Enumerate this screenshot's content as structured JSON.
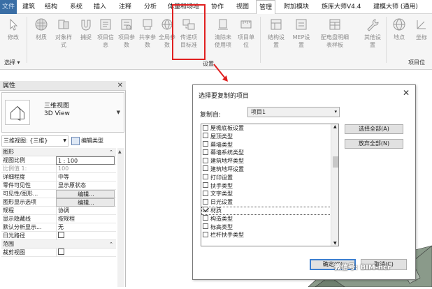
{
  "menubar": {
    "file": "文件",
    "tabs": [
      "建筑",
      "结构",
      "系统",
      "插入",
      "注释",
      "分析",
      "体量和场地",
      "协作",
      "视图",
      "管理",
      "附加模块",
      "族库大师V4.4",
      "建模大师 (通用)"
    ]
  },
  "ribbon": {
    "buttons": [
      {
        "label": "修改",
        "icon": "cursor-icon"
      },
      {
        "label": "材质",
        "icon": "material-sphere-icon"
      },
      {
        "label": "对象样式",
        "icon": "object-styles-icon"
      },
      {
        "label": "捕捉",
        "icon": "snap-magnet-icon"
      },
      {
        "label": "项目信息",
        "icon": "project-info-icon"
      },
      {
        "label": "项目参数",
        "icon": "project-params-icon"
      },
      {
        "label": "共享参数",
        "icon": "shared-params-icon"
      },
      {
        "label": "全局参数",
        "icon": "global-params-icon"
      },
      {
        "label": "传递项目标准",
        "icon": "transfer-standards-icon"
      },
      {
        "label": "清除未使用项",
        "icon": "purge-icon"
      },
      {
        "label": "项目单位",
        "icon": "project-units-icon"
      },
      {
        "label": "结构设置",
        "icon": "structural-settings-icon"
      },
      {
        "label": "MEP设置",
        "icon": "mep-settings-icon"
      },
      {
        "label": "配电盘明细表样板",
        "icon": "panel-schedule-icon"
      },
      {
        "label": "其他设置",
        "icon": "wrench-icon"
      },
      {
        "label": "地点",
        "icon": "location-globe-icon"
      },
      {
        "label": "坐标",
        "icon": "coordinates-icon"
      }
    ],
    "select_panel": "选择",
    "settings_panel": "设置",
    "project_location_panel": "项目位"
  },
  "properties": {
    "title": "属性",
    "type_name": "三维视图",
    "type_sub": "3D View",
    "view_selector": "三维视图: {三维}",
    "edit_type": "编辑类型",
    "sections": {
      "graphics": "图形",
      "extents": "范围"
    },
    "rows": [
      {
        "name": "视图比例",
        "value": "1 : 100"
      },
      {
        "name": "比例值 1:",
        "value": "100"
      },
      {
        "name": "详细程度",
        "value": "中等"
      },
      {
        "name": "零件可见性",
        "value": "显示原状态"
      },
      {
        "name": "可见性/图形...",
        "value": "编辑..."
      },
      {
        "name": "图形显示选项",
        "value": "编辑..."
      },
      {
        "name": "规程",
        "value": "协调"
      },
      {
        "name": "显示隐藏线",
        "value": "按规程"
      },
      {
        "name": "默认分析显示...",
        "value": "无"
      },
      {
        "name": "日光路径",
        "value": ""
      }
    ],
    "extent_rows": [
      {
        "name": "裁剪视图",
        "value": ""
      }
    ]
  },
  "dialog": {
    "title": "选择要复制的项目",
    "copy_from_label": "复制自:",
    "copy_from_value": "项目1",
    "items": [
      {
        "label": "屋檐底板设置",
        "checked": false
      },
      {
        "label": "屋顶类型",
        "checked": false
      },
      {
        "label": "幕墙类型",
        "checked": false
      },
      {
        "label": "幕墙系统类型",
        "checked": false
      },
      {
        "label": "建筑地坪类型",
        "checked": false
      },
      {
        "label": "建筑地坪设置",
        "checked": false
      },
      {
        "label": "打印设置",
        "checked": false
      },
      {
        "label": "扶手类型",
        "checked": false
      },
      {
        "label": "文字类型",
        "checked": false
      },
      {
        "label": "日光设置",
        "checked": false
      },
      {
        "label": "材质",
        "checked": true
      },
      {
        "label": "构造类型",
        "checked": false
      },
      {
        "label": "标高类型",
        "checked": false
      },
      {
        "label": "栏杆扶手类型",
        "checked": false
      }
    ],
    "select_all": "选择全部(A)",
    "deselect_all": "放弃全部(N)",
    "ok": "确定(O)",
    "cancel": "取消(C)"
  },
  "watermark": "微信号: BIM-ncr",
  "colors": {
    "highlight": "#e02020",
    "file_tab": "#3a6ea5",
    "ok_border": "#3c7fd1"
  }
}
